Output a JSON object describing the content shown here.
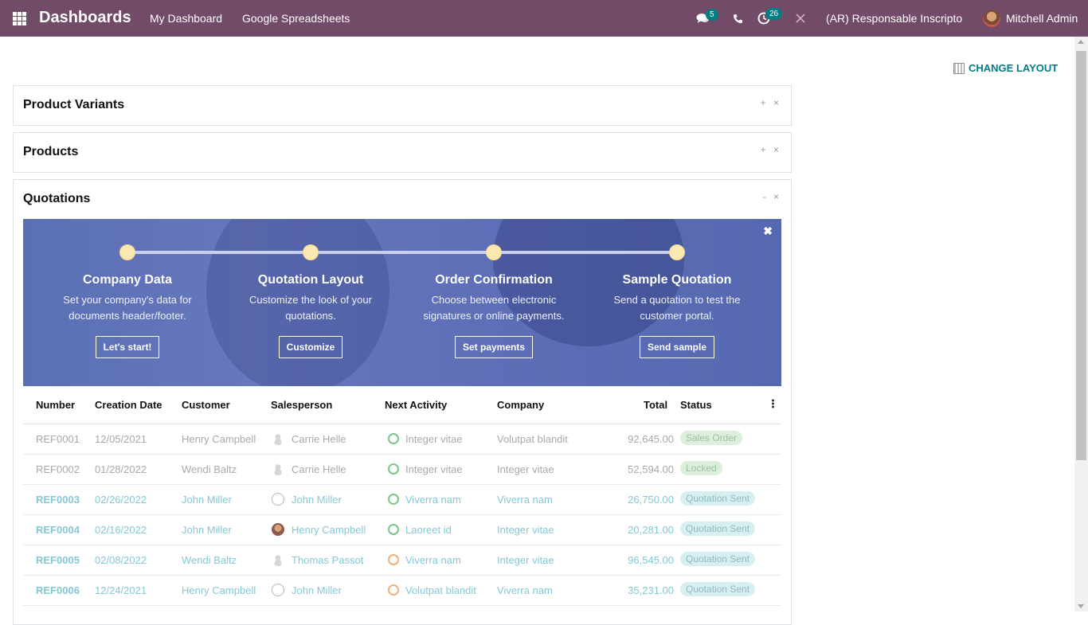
{
  "navbar": {
    "brand": "Dashboards",
    "menus": [
      "My Dashboard",
      "Google Spreadsheets"
    ],
    "messages_count": "5",
    "activities_count": "26",
    "company": "(AR) Responsable Inscripto",
    "user": "Mitchell Admin",
    "bg_color": "#714B67"
  },
  "toolbar": {
    "change_layout_label": "CHANGE LAYOUT"
  },
  "panels": {
    "product_variants": {
      "title": "Product Variants",
      "tools": "+ ×"
    },
    "products": {
      "title": "Products",
      "tools": "+ ×"
    },
    "quotations": {
      "title": "Quotations",
      "tools": "- ×"
    }
  },
  "onboarding": {
    "close": "✖",
    "steps": [
      {
        "title": "Company Data",
        "desc": "Set your company's data for documents header/footer.",
        "button": "Let's start!"
      },
      {
        "title": "Quotation Layout",
        "desc": "Customize the look of your quotations.",
        "button": "Customize"
      },
      {
        "title": "Order Confirmation",
        "desc": "Choose between electronic signatures or online payments.",
        "button": "Set payments"
      },
      {
        "title": "Sample Quotation",
        "desc": "Send a quotation to test the customer portal.",
        "button": "Send sample"
      }
    ]
  },
  "table": {
    "headers": [
      "Number",
      "Creation Date",
      "Customer",
      "Salesperson",
      "Next Activity",
      "Company",
      "Total",
      "Status"
    ],
    "rows": [
      {
        "number": "REF0001",
        "date": "12/05/2021",
        "customer": "Henry Campbell",
        "salesperson": "Carrie Helle",
        "activity": "Integer vitae",
        "company": "Volutpat blandit",
        "total": "92,645.00",
        "status": "Sales Order"
      },
      {
        "number": "REF0002",
        "date": "01/28/2022",
        "customer": "Wendi Baltz",
        "salesperson": "Carrie Helle",
        "activity": "Integer vitae",
        "company": "Integer vitae",
        "total": "52,594.00",
        "status": "Locked"
      },
      {
        "number": "REF0003",
        "date": "02/26/2022",
        "customer": "John Miller",
        "salesperson": "John Miller",
        "activity": "Viverra nam",
        "company": "Viverra nam",
        "total": "26,750.00",
        "status": "Quotation Sent"
      },
      {
        "number": "REF0004",
        "date": "02/16/2022",
        "customer": "John Miller",
        "salesperson": "Henry Campbell",
        "activity": "Laoreet id",
        "company": "Integer vitae",
        "total": "20,281.00",
        "status": "Quotation Sent"
      },
      {
        "number": "REF0005",
        "date": "02/08/2022",
        "customer": "Wendi Baltz",
        "salesperson": "Thomas Passot",
        "activity": "Viverra nam",
        "company": "Integer vitae",
        "total": "96,545.00",
        "status": "Quotation Sent"
      },
      {
        "number": "REF0006",
        "date": "12/24/2021",
        "customer": "Henry Campbell",
        "salesperson": "John Miller",
        "activity": "Volutpat blandit",
        "company": "Viverra nam",
        "total": "35,231.00",
        "status": "Quotation Sent"
      }
    ]
  }
}
